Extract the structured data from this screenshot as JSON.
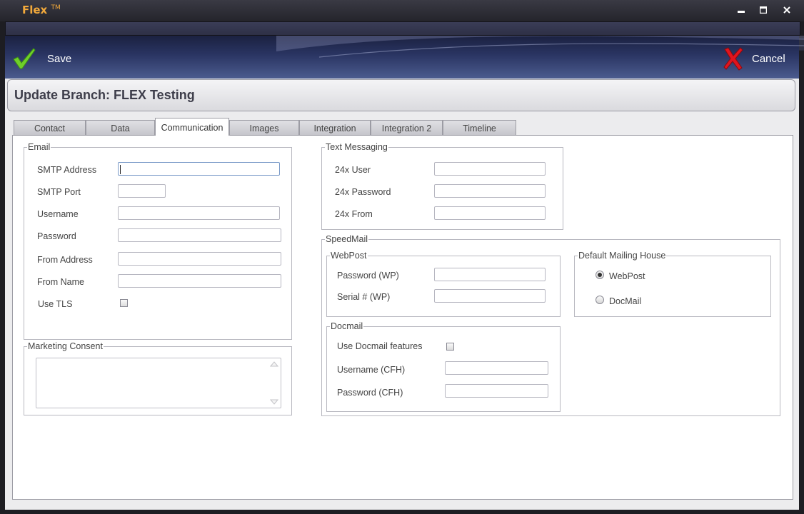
{
  "window": {
    "app_title": "Flex",
    "trademark": "TM",
    "controls": {
      "minimize": "▬",
      "maximize": "■",
      "close": "✕"
    }
  },
  "toolbar": {
    "save_label": "Save",
    "cancel_label": "Cancel"
  },
  "page": {
    "title": "Update Branch: FLEX Testing"
  },
  "tabs": [
    {
      "label": "Contact",
      "active": false
    },
    {
      "label": "Data",
      "active": false
    },
    {
      "label": "Communication",
      "active": true
    },
    {
      "label": "Images",
      "active": false
    },
    {
      "label": "Integration",
      "active": false
    },
    {
      "label": "Integration 2",
      "active": false
    },
    {
      "label": "Timeline",
      "active": false
    }
  ],
  "email": {
    "legend": "Email",
    "smtp_address_label": "SMTP Address",
    "smtp_address_value": "",
    "smtp_port_label": "SMTP Port",
    "smtp_port_value": "",
    "username_label": "Username",
    "username_value": "",
    "password_label": "Password",
    "password_value": "",
    "from_address_label": "From Address",
    "from_address_value": "",
    "from_name_label": "From Name",
    "from_name_value": "",
    "use_tls_label": "Use TLS",
    "use_tls_checked": false
  },
  "marketing": {
    "legend": "Marketing Consent",
    "value": ""
  },
  "text_messaging": {
    "legend": "Text Messaging",
    "user_label": "24x User",
    "user_value": "",
    "password_label": "24x Password",
    "password_value": "",
    "from_label": "24x From",
    "from_value": ""
  },
  "speedmail": {
    "legend": "SpeedMail",
    "webpost": {
      "legend": "WebPost",
      "password_label": "Password (WP)",
      "password_value": "",
      "serial_label": "Serial # (WP)",
      "serial_value": ""
    },
    "mailing_house": {
      "legend": "Default Mailing House",
      "options": [
        {
          "label": "WebPost",
          "selected": true
        },
        {
          "label": "DocMail",
          "selected": false
        }
      ]
    },
    "docmail": {
      "legend": "Docmail",
      "use_features_label": "Use Docmail features",
      "use_features_checked": false,
      "username_label": "Username (CFH)",
      "username_value": "",
      "password_label": "Password (CFH)",
      "password_value": ""
    }
  },
  "colors": {
    "app_title": "#f2a93b",
    "save_check": "#6fcf2a",
    "cancel_x": "#e0141e",
    "toolbar_dark": "#1b2140",
    "toolbar_light": "#4b5b8e"
  }
}
